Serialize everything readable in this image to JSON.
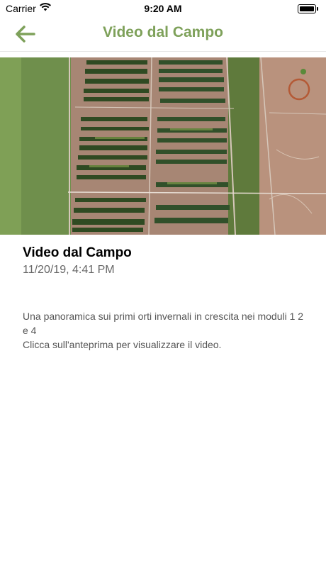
{
  "status_bar": {
    "carrier": "Carrier",
    "time": "9:20 AM",
    "battery_level": 1.0
  },
  "nav": {
    "title": "Video dal Campo",
    "back_icon": "arrow-left-icon",
    "accent": "#7ea15a"
  },
  "video": {
    "preview_icon": "video-thumbnail"
  },
  "post": {
    "title": "Video dal Campo",
    "date": "11/20/19, 4:41 PM",
    "description": "Una panoramica sui primi orti invernali in crescita nei moduli 1 2 e 4\nClicca sull'anteprima per visualizzare il video."
  }
}
